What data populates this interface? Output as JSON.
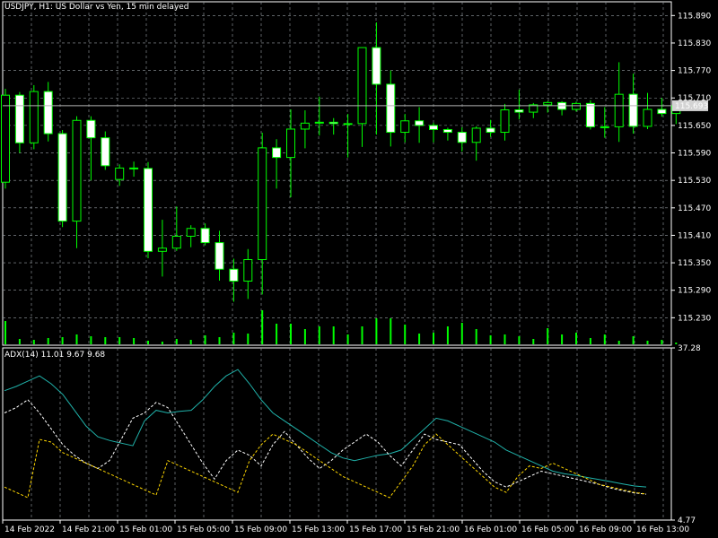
{
  "header": {
    "symbol_info": "USDJPY, H1:  US Dollar vs Yen, 15 min delayed"
  },
  "indicator": {
    "label": "ADX(14) 11.01 9.67 9.68"
  },
  "colors": {
    "background": "#000000",
    "grid": "#9aa0a6",
    "frame": "#ffffff",
    "bull_body": "#000000",
    "bear_body": "#ffffff",
    "candle_outline": "#00ff00",
    "volume": "#00ff00",
    "adx_line": "#20b2aa",
    "plus_di": "#ffffff",
    "minus_di": "#ffd700",
    "bid_line": "#b4b4b4",
    "price_tag_bg": "#d3d3d3",
    "price_tag_text": "#000000"
  },
  "chart_data": [
    {
      "type": "candlestick",
      "symbol": "USDJPY",
      "timeframe": "H1",
      "ylim": [
        115.17,
        115.92
      ],
      "y_ticks": [
        "115.890",
        "115.830",
        "115.770",
        "115.710",
        "115.650",
        "115.590",
        "115.530",
        "115.470",
        "115.410",
        "115.350",
        "115.290",
        "115.230"
      ],
      "current_price": "115.693",
      "x_ticks": [
        "14 Feb 2022",
        "14 Feb 21:00",
        "15 Feb 01:00",
        "15 Feb 05:00",
        "15 Feb 09:00",
        "15 Feb 13:00",
        "15 Feb 17:00",
        "15 Feb 21:00",
        "16 Feb 01:00",
        "16 Feb 05:00",
        "16 Feb 09:00",
        "16 Feb 13:00"
      ],
      "ohlc": [
        [
          115.526,
          115.73,
          115.512,
          115.716
        ],
        [
          115.716,
          115.723,
          115.59,
          115.612
        ],
        [
          115.612,
          115.738,
          115.598,
          115.724
        ],
        [
          115.724,
          115.745,
          115.615,
          115.632
        ],
        [
          115.632,
          115.64,
          115.428,
          115.441
        ],
        [
          115.441,
          115.67,
          115.382,
          115.661
        ],
        [
          115.661,
          115.67,
          115.53,
          115.623
        ],
        [
          115.623,
          115.637,
          115.553,
          115.562
        ],
        [
          115.532,
          115.565,
          115.518,
          115.557
        ],
        [
          115.557,
          115.571,
          115.538,
          115.556
        ],
        [
          115.556,
          115.57,
          115.36,
          115.375
        ],
        [
          115.375,
          115.444,
          115.32,
          115.382
        ],
        [
          115.382,
          115.473,
          115.376,
          115.408
        ],
        [
          115.408,
          115.432,
          115.384,
          115.425
        ],
        [
          115.425,
          115.436,
          115.388,
          115.394
        ],
        [
          115.394,
          115.42,
          115.311,
          115.336
        ],
        [
          115.336,
          115.359,
          115.265,
          115.31
        ],
        [
          115.31,
          115.38,
          115.271,
          115.357
        ],
        [
          115.357,
          115.634,
          115.281,
          115.601
        ],
        [
          115.601,
          115.62,
          115.512,
          115.58
        ],
        [
          115.58,
          115.685,
          115.493,
          115.642
        ],
        [
          115.642,
          115.683,
          115.6,
          115.655
        ],
        [
          115.655,
          115.713,
          115.628,
          115.657
        ],
        [
          115.657,
          115.666,
          115.63,
          115.654
        ],
        [
          115.654,
          115.675,
          115.58,
          115.654
        ],
        [
          115.654,
          115.813,
          115.603,
          115.82
        ],
        [
          115.82,
          115.875,
          115.63,
          115.74
        ],
        [
          115.74,
          115.77,
          115.604,
          115.635
        ],
        [
          115.635,
          115.675,
          115.613,
          115.66
        ],
        [
          115.66,
          115.69,
          115.612,
          115.65
        ],
        [
          115.65,
          115.656,
          115.613,
          115.641
        ],
        [
          115.641,
          115.645,
          115.617,
          115.635
        ],
        [
          115.635,
          115.646,
          115.593,
          115.613
        ],
        [
          115.613,
          115.648,
          115.573,
          115.644
        ],
        [
          115.644,
          115.662,
          115.625,
          115.635
        ],
        [
          115.635,
          115.697,
          115.617,
          115.684
        ],
        [
          115.684,
          115.728,
          115.663,
          115.679
        ],
        [
          115.679,
          115.699,
          115.666,
          115.695
        ],
        [
          115.695,
          115.703,
          115.678,
          115.7
        ],
        [
          115.7,
          115.703,
          115.672,
          115.685
        ],
        [
          115.685,
          115.702,
          115.68,
          115.698
        ],
        [
          115.698,
          115.705,
          115.641,
          115.647
        ],
        [
          115.647,
          115.69,
          115.623,
          115.647
        ],
        [
          115.647,
          115.788,
          115.614,
          115.718
        ],
        [
          115.718,
          115.763,
          115.632,
          115.648
        ],
        [
          115.648,
          115.721,
          115.642,
          115.685
        ],
        [
          115.685,
          115.71,
          115.669,
          115.676
        ],
        [
          115.676,
          115.703,
          115.653,
          115.693
        ]
      ],
      "volume": [
        26,
        6,
        5,
        7,
        8,
        11,
        9,
        8,
        8,
        7,
        4,
        3,
        6,
        5,
        10,
        8,
        13,
        12,
        38,
        23,
        23,
        17,
        20,
        20,
        11,
        20,
        29,
        29,
        22,
        12,
        13,
        20,
        24,
        17,
        10,
        11,
        9,
        6,
        18,
        11,
        13,
        7,
        11,
        4,
        9,
        4,
        5,
        2
      ]
    },
    {
      "type": "line",
      "title": "ADX(14)",
      "ylim": [
        4.77,
        37.28
      ],
      "y_ticks": [
        "37.28",
        "4.77"
      ],
      "series": [
        {
          "name": "ADX",
          "values": [
            29.2,
            30.0,
            31.0,
            32.0,
            30.5,
            28.5,
            25.5,
            22.5,
            20.5,
            19.8,
            19.3,
            18.8,
            23.5,
            25.5,
            25.0,
            25.3,
            25.5,
            27.5,
            30.0,
            32.0,
            33.2,
            30.5,
            27.5,
            25.0,
            23.5,
            22.0,
            20.5,
            19.0,
            17.5,
            16.5,
            16.0,
            16.5,
            17.0,
            17.3,
            18.0,
            20.0,
            22.0,
            24.0,
            23.5,
            22.5,
            21.5,
            20.5,
            19.5,
            18.0,
            17.0,
            16.0,
            15.0,
            14.0,
            13.5,
            13.2,
            12.8,
            12.4,
            12.0,
            11.6,
            11.2,
            11.01
          ]
        },
        {
          "name": "+DI",
          "values": [
            25.0,
            26.0,
            27.5,
            25.0,
            22.0,
            19.0,
            17.0,
            15.5,
            14.5,
            16.0,
            20.0,
            24.0,
            25.0,
            27.0,
            26.0,
            22.5,
            19.0,
            15.5,
            12.5,
            16.0,
            18.0,
            17.0,
            15.0,
            19.0,
            21.5,
            19.0,
            16.5,
            14.5,
            16.0,
            18.0,
            19.5,
            21.0,
            19.5,
            17.0,
            15.0,
            18.0,
            21.0,
            20.0,
            19.5,
            19.0,
            16.5,
            14.0,
            12.0,
            11.0,
            12.0,
            13.0,
            14.0,
            13.5,
            13.0,
            12.5,
            12.0,
            11.5,
            10.8,
            10.3,
            9.9,
            9.67
          ]
        },
        {
          "name": "-DI",
          "values": [
            11.0,
            10.0,
            9.0,
            20.0,
            19.5,
            17.5,
            16.5,
            15.5,
            14.5,
            13.5,
            12.5,
            11.5,
            10.5,
            9.5,
            16.0,
            15.0,
            14.0,
            13.0,
            12.0,
            11.0,
            10.0,
            16.0,
            19.0,
            21.0,
            20.0,
            19.0,
            17.5,
            16.0,
            14.5,
            13.0,
            12.0,
            11.0,
            10.0,
            9.0,
            12.0,
            15.0,
            19.0,
            21.0,
            19.0,
            17.0,
            15.0,
            13.0,
            11.0,
            10.0,
            13.0,
            15.0,
            14.5,
            15.5,
            14.5,
            13.5,
            12.5,
            11.5,
            11.0,
            10.5,
            10.0,
            9.68
          ]
        }
      ]
    }
  ]
}
